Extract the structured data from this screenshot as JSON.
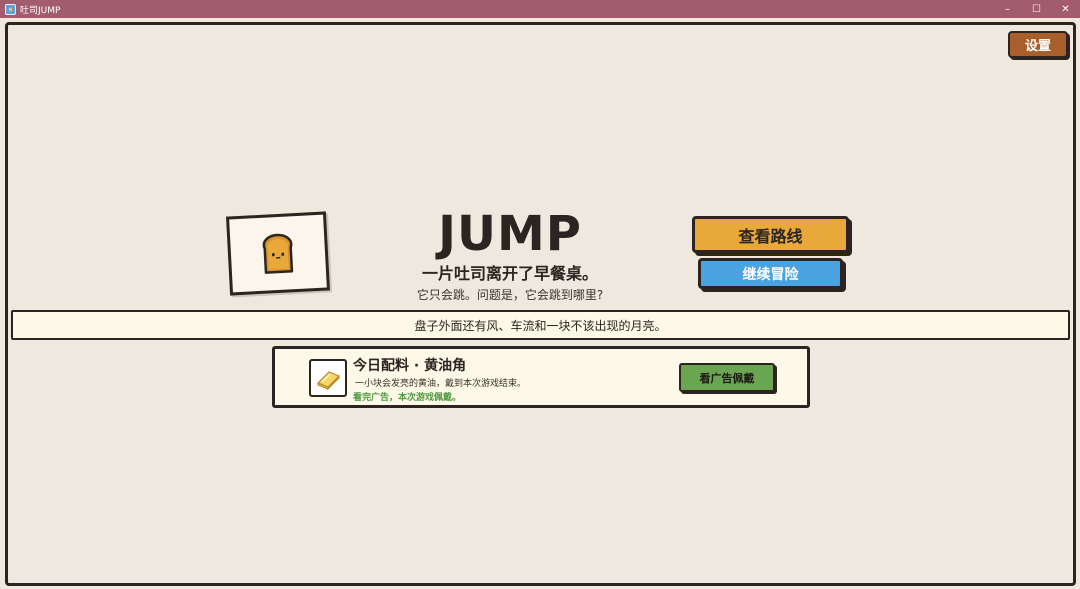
{
  "window": {
    "title": "吐司JUMP",
    "minimize_label": "–",
    "maximize_label": "☐",
    "close_label": "✕"
  },
  "header": {
    "settings_label": "设置"
  },
  "hero": {
    "title": "JUMP",
    "subtitle": "一片吐司离开了早餐桌。",
    "tagline": "它只会跳。问题是，它会跳到哪里?"
  },
  "actions": {
    "route_label": "查看路线",
    "continue_label": "继续冒险"
  },
  "banner": {
    "text": "盘子外面还有风、车流和一块不该出现的月亮。"
  },
  "daily": {
    "title": "今日配料 · 黄油角",
    "description": "一小块会发亮的黄油，戴到本次游戏结束。",
    "hint": "看完广告，本次游戏佩戴。",
    "ad_button_label": "看广告佩戴"
  },
  "colors": {
    "titlebar": "#a35c6e",
    "background": "#efe8de",
    "route_button": "#e8a83a",
    "continue_button": "#4aa3e0",
    "settings_button": "#a85f2c",
    "ad_button": "#6aa652",
    "hint_text": "#4f9a3f"
  }
}
